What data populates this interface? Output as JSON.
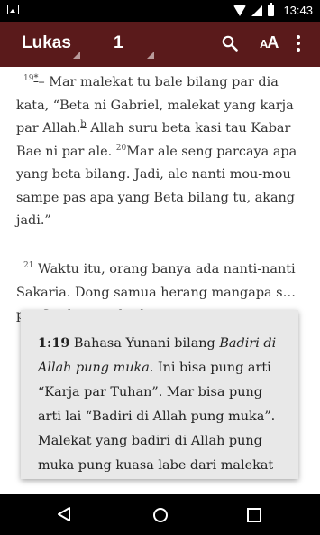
{
  "status_bar": {
    "time": "13:43"
  },
  "toolbar": {
    "book": "Lukas",
    "chapter": "1"
  },
  "content": {
    "p1": {
      "v19_num": "19",
      "v19_fnmark": "*",
      "v19_text": "– Mar malekat tu bale bilang par dia kata, “Beta ni Gabriel, malekat yang karja par Allah.",
      "fn_b": "b",
      "v19_text2": " Allah suru beta kasi tau Kabar Bae ni par ale. ",
      "v20_num": "20",
      "v20_text": "Mar ale seng parcaya apa yang beta bilang. Jadi, ale nanti mou-mou sampe pas apa yang Beta bilang tu, akang jadi.”"
    },
    "p2": {
      "v21_num": "21",
      "v21_text": "Waktu itu, orang banya ada nanti-nanti Sakaria. Dong samua herang mangapa s… p… S… la… t… l… k…"
    }
  },
  "popup": {
    "ref": "1:19",
    "text_a": " Bahasa Yunani bilang ",
    "italic": "Badiri di Allah pung muka.",
    "text_b": " Ini bisa pung arti “Karja par Tuhan”. Mar bisa pung arti lai “Badiri di Allah pung muka”. Malekat yang badiri di Allah pung muka pung kuasa labe dari malekat"
  }
}
